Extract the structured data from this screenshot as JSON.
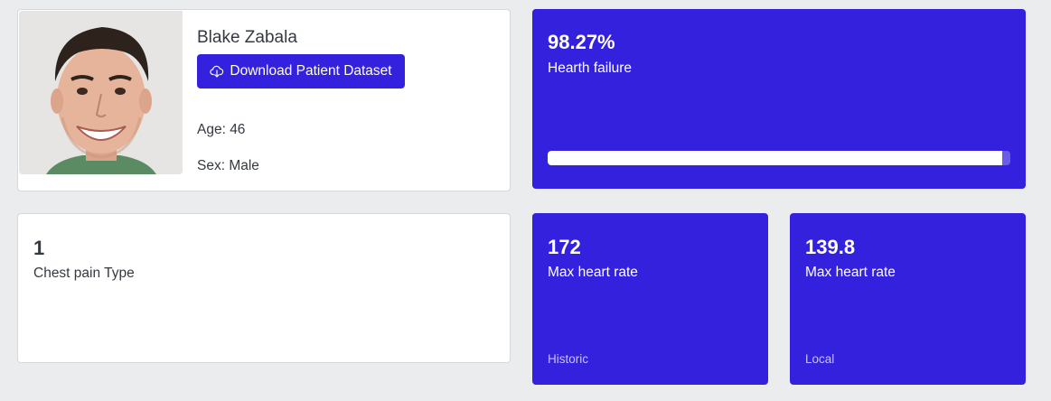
{
  "patient": {
    "name": "Blake Zabala",
    "download_label": "Download Patient Dataset",
    "age": "Age: 46",
    "sex": "Sex: Male"
  },
  "failure": {
    "value": "98.27%",
    "label": "Hearth failure",
    "progress": 0.9827
  },
  "chest": {
    "value": "1",
    "label": "Chest pain Type"
  },
  "hr_historic": {
    "value": "172",
    "label": "Max heart rate",
    "footer": "Historic"
  },
  "hr_local": {
    "value": "139.8",
    "label": "Max heart rate",
    "footer": "Local"
  },
  "colors": {
    "accent": "#3421dd",
    "background": "#ebecee"
  },
  "icons": {
    "download": "cloud-download-icon"
  }
}
